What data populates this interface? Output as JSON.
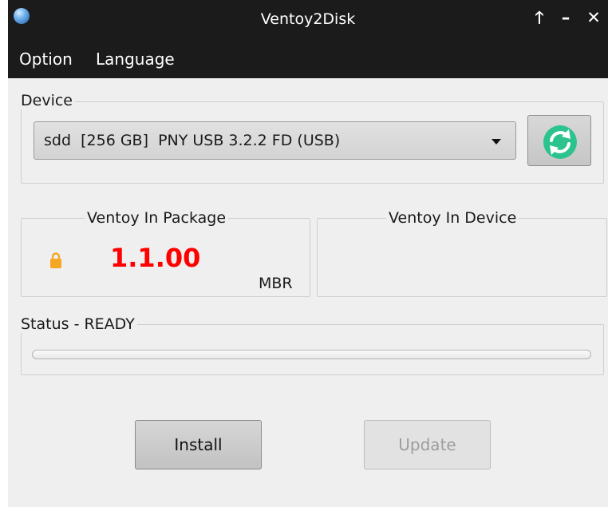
{
  "window": {
    "title": "Ventoy2Disk"
  },
  "window_controls": {
    "maximize": "🡑",
    "minimize": "–",
    "close": "✕"
  },
  "menu": {
    "option": "Option",
    "language": "Language"
  },
  "device": {
    "group_label": "Device",
    "selected": "sdd  [256 GB]  PNY USB 3.2.2 FD (USB)"
  },
  "package": {
    "group_label": "Ventoy In Package",
    "version": "1.1.00",
    "partition_style": "MBR"
  },
  "device_version": {
    "group_label": "Ventoy In Device",
    "version": ""
  },
  "status": {
    "label": "Status - READY",
    "progress": 0
  },
  "buttons": {
    "install": "Install",
    "update": "Update"
  },
  "colors": {
    "titlebar": "#1b1b1b",
    "window_bg": "#efefef",
    "version_red": "#ff0000",
    "refresh_teal": "#2cc38e",
    "lock_orange": "#f5a623"
  },
  "icons": {
    "app": "ventoy-app-icon",
    "refresh": "refresh-icon",
    "lock": "lock-icon"
  }
}
